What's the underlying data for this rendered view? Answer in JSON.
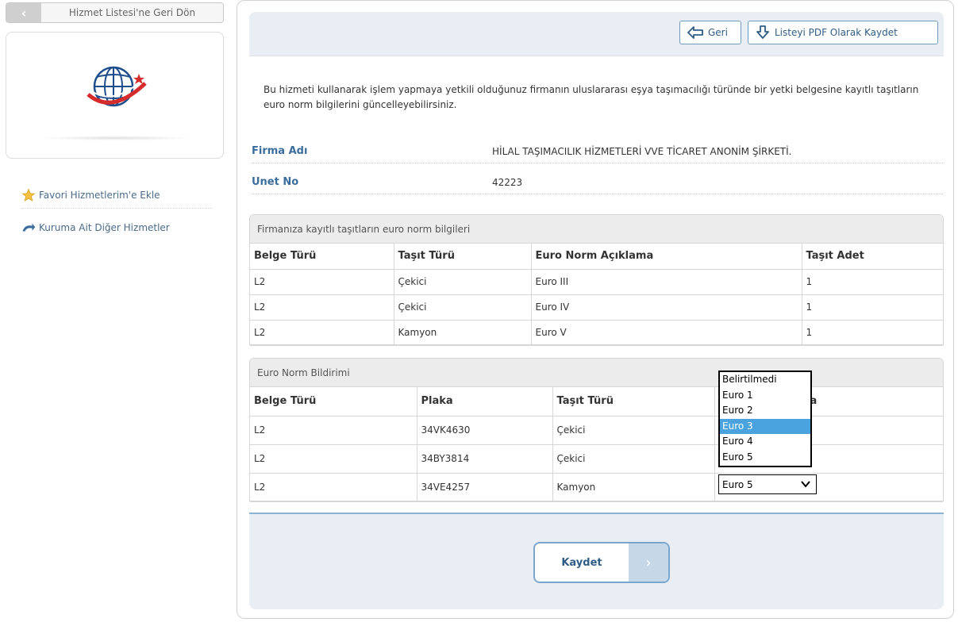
{
  "sidebar": {
    "back_label": "Hizmet Listesi'ne Geri Dön",
    "fav_label": "Favori Hizmetlerim'e Ekle",
    "other_label": "Kuruma Ait Diğer Hizmetler"
  },
  "toolbar": {
    "back_label": "Geri",
    "pdf_label": "Listeyi PDF Olarak Kaydet"
  },
  "intro": "Bu hizmeti kullanarak işlem yapmaya yetkili olduğunuz firmanın uluslararası eşya taşımacılığı türünde bir yetki belgesine kayıtlı taşıtların euro norm bilgilerini güncelleyebilirsiniz.",
  "company": {
    "firma_label": "Firma Adı",
    "firma_value": "HİLAL TAŞIMACILIK HİZMETLERİ VVE TİCARET ANONİM ŞİRKETİ.",
    "unet_label": "Unet No",
    "unet_value": "42223"
  },
  "registered": {
    "title": "Firmanıza kayıtlı taşıtların euro norm bilgileri",
    "headers": [
      "Belge Türü",
      "Taşıt Türü",
      "Euro Norm Açıklama",
      "Taşıt Adet"
    ],
    "rows": [
      [
        "L2",
        "Çekici",
        "Euro III",
        "1"
      ],
      [
        "L2",
        "Çekici",
        "Euro IV",
        "1"
      ],
      [
        "L2",
        "Kamyon",
        "Euro V",
        "1"
      ]
    ]
  },
  "declaration": {
    "title": "Euro Norm Bildirimi",
    "headers": [
      "Belge Türü",
      "Plaka",
      "Taşıt Türü",
      "a"
    ],
    "rows": [
      [
        "L2",
        "34VK4630",
        "Çekici"
      ],
      [
        "L2",
        "34BY3814",
        "Çekici"
      ],
      [
        "L2",
        "34VE4257",
        "Kamyon"
      ]
    ],
    "select_value": "Euro 5",
    "options": [
      "Belirtilmedi",
      "Euro 1",
      "Euro 2",
      "Euro 3",
      "Euro 4",
      "Euro 5"
    ],
    "highlighted_option": "Euro 3"
  },
  "save_label": "Kaydet",
  "colors": {
    "accent": "#3a6d9c",
    "panel": "#e9eef4",
    "highlight": "#4aa3df"
  }
}
